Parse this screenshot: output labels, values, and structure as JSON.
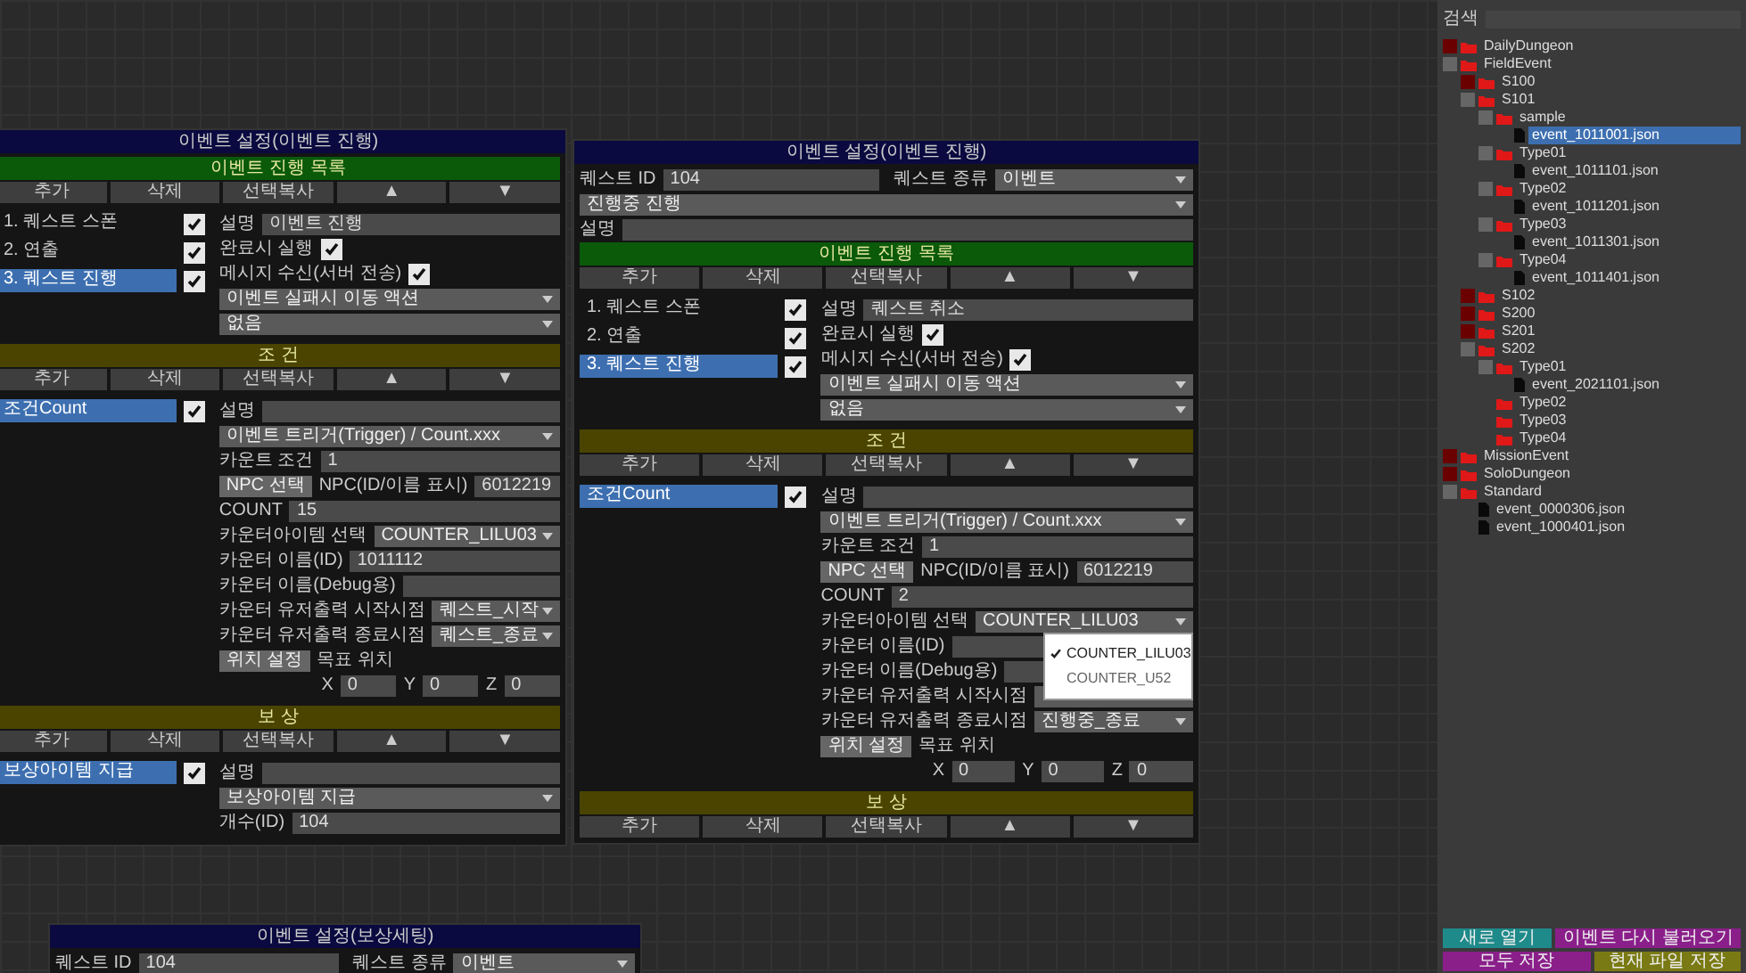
{
  "search": {
    "label": "검색"
  },
  "windows": [
    {
      "title": "이벤트 설정(이벤트 진행)",
      "sections": [
        {
          "bar": {
            "label": "이벤트 진행 목록",
            "color": "#0a5a0a"
          },
          "toolbar": [
            "추가",
            "삭제",
            "선택복사",
            "▲",
            "▼"
          ],
          "items": [
            {
              "label": "1. 퀘스트 스폰",
              "checked": true,
              "selected": false
            },
            {
              "label": "2. 연출",
              "checked": true,
              "selected": false
            },
            {
              "label": "3. 퀘스트 진행",
              "checked": true,
              "selected": true
            }
          ],
          "props": [
            {
              "kind": "field",
              "label": "설명",
              "value": "이벤트 진행"
            },
            {
              "kind": "check",
              "label": "완료시 실행",
              "checked": true
            },
            {
              "kind": "check",
              "label": "메시지 수신(서버 전송)",
              "checked": true
            },
            {
              "kind": "dropdown",
              "value": "이벤트 실패시 이동 액션"
            },
            {
              "kind": "dropdown",
              "value": "없음"
            }
          ]
        },
        {
          "bar": {
            "label": "조 건",
            "color": "#4a4400"
          },
          "toolbar": [
            "추가",
            "삭제",
            "선택복사",
            "▲",
            "▼"
          ],
          "items": [
            {
              "label": "조건Count",
              "checked": true,
              "selected": true
            }
          ],
          "props": [
            {
              "kind": "field",
              "label": "설명"
            },
            {
              "kind": "dropdown",
              "value": "이벤트 트리거(Trigger) / Count.xxx"
            },
            {
              "kind": "field",
              "label": "카운트 조건",
              "value": "1"
            },
            {
              "kind": "button_field",
              "button": "NPC 선택",
              "label": "NPC(ID/이름 표시)",
              "value": "6012219"
            },
            {
              "kind": "field",
              "label": "COUNT",
              "value": "15"
            },
            {
              "kind": "label_dropdown",
              "label": "카운터아이템 선택",
              "value": "COUNTER_LILU03"
            },
            {
              "kind": "field",
              "label": "카운터 이름(ID)",
              "value": "1011112"
            },
            {
              "kind": "field",
              "label": "카운터 이름(Debug용)"
            },
            {
              "kind": "label_dropdown",
              "label": "카운터 유저출력 시작시점",
              "value": "퀘스트_시작"
            },
            {
              "kind": "label_dropdown",
              "label": "카운터 유저출력 종료시점",
              "value": "퀘스트_종료"
            },
            {
              "kind": "vector",
              "button": "위치 설정",
              "label": "목표 위치",
              "parts": [
                {
                  "label": "X",
                  "value": "0"
                },
                {
                  "label": "Y",
                  "value": "0"
                },
                {
                  "label": "Z",
                  "value": "0"
                }
              ]
            }
          ]
        },
        {
          "bar": {
            "label": "보 상",
            "color": "#4a4400"
          },
          "toolbar": [
            "추가",
            "삭제",
            "선택복사",
            "▲",
            "▼"
          ],
          "items": [
            {
              "label": "보상아이템 지급",
              "checked": true,
              "selected": true
            }
          ],
          "props": [
            {
              "kind": "field",
              "label": "설명"
            },
            {
              "kind": "dropdown",
              "value": "보상아이템 지급"
            },
            {
              "kind": "field",
              "label": "개수(ID)",
              "value": "104"
            }
          ]
        }
      ]
    },
    {
      "title": "이벤트 설정(이벤트 진행)",
      "header": [
        [
          {
            "kind": "field",
            "label": "퀘스트 ID",
            "value": "104"
          },
          {
            "kind": "label_dropdown",
            "label": "퀘스트 종류",
            "value": "이벤트"
          }
        ],
        [
          {
            "kind": "dropdown",
            "value": "진행중 진행"
          }
        ],
        [
          {
            "kind": "field",
            "label": "설명"
          }
        ]
      ],
      "sections": [
        {
          "bar": {
            "label": "이벤트 진행 목록",
            "color": "#0a5a0a"
          },
          "toolbar": [
            "추가",
            "삭제",
            "선택복사",
            "▲",
            "▼"
          ],
          "items": [
            {
              "label": "1. 퀘스트 스폰",
              "checked": true,
              "selected": false
            },
            {
              "label": "2. 연출",
              "checked": true,
              "selected": false
            },
            {
              "label": "3. 퀘스트 진행",
              "checked": true,
              "selected": true
            }
          ],
          "props": [
            {
              "kind": "field",
              "label": "설명",
              "value": "퀘스트 취소"
            },
            {
              "kind": "check",
              "label": "완료시 실행",
              "checked": true
            },
            {
              "kind": "check",
              "label": "메시지 수신(서버 전송)",
              "checked": true
            },
            {
              "kind": "dropdown",
              "value": "이벤트 실패시 이동 액션"
            },
            {
              "kind": "dropdown",
              "value": "없음"
            }
          ]
        },
        {
          "bar": {
            "label": "조 건",
            "color": "#4a4400"
          },
          "toolbar": [
            "추가",
            "삭제",
            "선택복사",
            "▲",
            "▼"
          ],
          "items": [
            {
              "label": "조건Count",
              "checked": true,
              "selected": true
            }
          ],
          "props": [
            {
              "kind": "field",
              "label": "설명"
            },
            {
              "kind": "dropdown",
              "value": "이벤트 트리거(Trigger) / Count.xxx"
            },
            {
              "kind": "field",
              "label": "카운트 조건",
              "value": "1"
            },
            {
              "kind": "button_field",
              "button": "NPC 선택",
              "label": "NPC(ID/이름 표시)",
              "value": "6012219"
            },
            {
              "kind": "field",
              "label": "COUNT",
              "value": "2"
            },
            {
              "kind": "label_dropdown",
              "label": "카운터아이템 선택",
              "value": "COUNTER_LILU03",
              "menu": [
                {
                  "label": "COUNTER_LILU03",
                  "selected": true
                },
                {
                  "label": "COUNTER_U52",
                  "selected": false
                }
              ]
            },
            {
              "kind": "field",
              "label": "카운터 이름(ID)"
            },
            {
              "kind": "field",
              "label": "카운터 이름(Debug용)"
            },
            {
              "kind": "label_dropdown",
              "label": "카운터 유저출력 시작시점"
            },
            {
              "kind": "label_dropdown",
              "label": "카운터 유저출력 종료시점",
              "value": "진행중_종료"
            },
            {
              "kind": "vector",
              "button": "위치 설정",
              "label": "목표 위치",
              "parts": [
                {
                  "label": "X",
                  "value": "0"
                },
                {
                  "label": "Y",
                  "value": "0"
                },
                {
                  "label": "Z",
                  "value": "0"
                }
              ]
            }
          ]
        },
        {
          "bar": {
            "label": "보 상",
            "color": "#4a4400"
          },
          "toolbar": [
            "추가",
            "삭제",
            "선택복사",
            "▲",
            "▼"
          ]
        }
      ]
    },
    {
      "title": "이벤트 설정(보상세팅)",
      "header": [
        [
          {
            "kind": "field",
            "label": "퀘스트 ID",
            "value": "104"
          },
          {
            "kind": "label_dropdown",
            "label": "퀘스트 종류",
            "value": "이벤트"
          }
        ]
      ]
    }
  ],
  "tree": [
    {
      "label": "DailyDungeon",
      "kind": "folder",
      "expanded": false
    },
    {
      "label": "FieldEvent",
      "kind": "folder",
      "expanded": true,
      "children": [
        {
          "label": "S100",
          "kind": "folder",
          "expanded": false
        },
        {
          "label": "S101",
          "kind": "folder",
          "expanded": true,
          "children": [
            {
              "label": "sample",
              "kind": "folder",
              "expanded": true,
              "children": [
                {
                  "label": "event_1011001.json",
                  "kind": "file",
                  "selected": true
                }
              ]
            },
            {
              "label": "Type01",
              "kind": "folder",
              "expanded": true,
              "children": [
                {
                  "label": "event_1011101.json",
                  "kind": "file",
                  "selected": false
                }
              ]
            },
            {
              "label": "Type02",
              "kind": "folder",
              "expanded": true,
              "children": [
                {
                  "label": "event_1011201.json",
                  "kind": "file",
                  "selected": false
                }
              ]
            },
            {
              "label": "Type03",
              "kind": "folder",
              "expanded": true,
              "children": [
                {
                  "label": "event_1011301.json",
                  "kind": "file",
                  "selected": false
                }
              ]
            },
            {
              "label": "Type04",
              "kind": "folder",
              "expanded": true,
              "children": [
                {
                  "label": "event_1011401.json",
                  "kind": "file",
                  "selected": false
                }
              ]
            }
          ]
        },
        {
          "label": "S102",
          "kind": "folder",
          "expanded": false
        },
        {
          "label": "S200",
          "kind": "folder",
          "expanded": false
        },
        {
          "label": "S201",
          "kind": "folder",
          "expanded": false
        },
        {
          "label": "S202",
          "kind": "folder",
          "expanded": true,
          "children": [
            {
              "label": "Type01",
              "kind": "folder",
              "expanded": true,
              "children": [
                {
                  "label": "event_2021101.json",
                  "kind": "file",
                  "selected": false
                }
              ]
            },
            {
              "label": "Type02",
              "kind": "folder"
            },
            {
              "label": "Type03",
              "kind": "folder"
            },
            {
              "label": "Type04",
              "kind": "folder"
            }
          ]
        }
      ]
    },
    {
      "label": "MissionEvent",
      "kind": "folder",
      "expanded": false
    },
    {
      "label": "SoloDungeon",
      "kind": "folder",
      "expanded": false
    },
    {
      "label": "Standard",
      "kind": "folder",
      "expanded": true,
      "children": [
        {
          "label": "event_0000306.json",
          "kind": "file",
          "selected": false
        },
        {
          "label": "event_1000401.json",
          "kind": "file",
          "selected": false
        }
      ]
    }
  ],
  "actions": [
    {
      "label": "새로 열기",
      "color": "#1f8a8a"
    },
    {
      "label": "이벤트 다시 불러오기",
      "color": "#8a1f8a"
    },
    {
      "label": "모두 저장",
      "color": "#8a1f8a"
    },
    {
      "label": "현재 파일 저장",
      "color": "#7a7a14"
    }
  ]
}
